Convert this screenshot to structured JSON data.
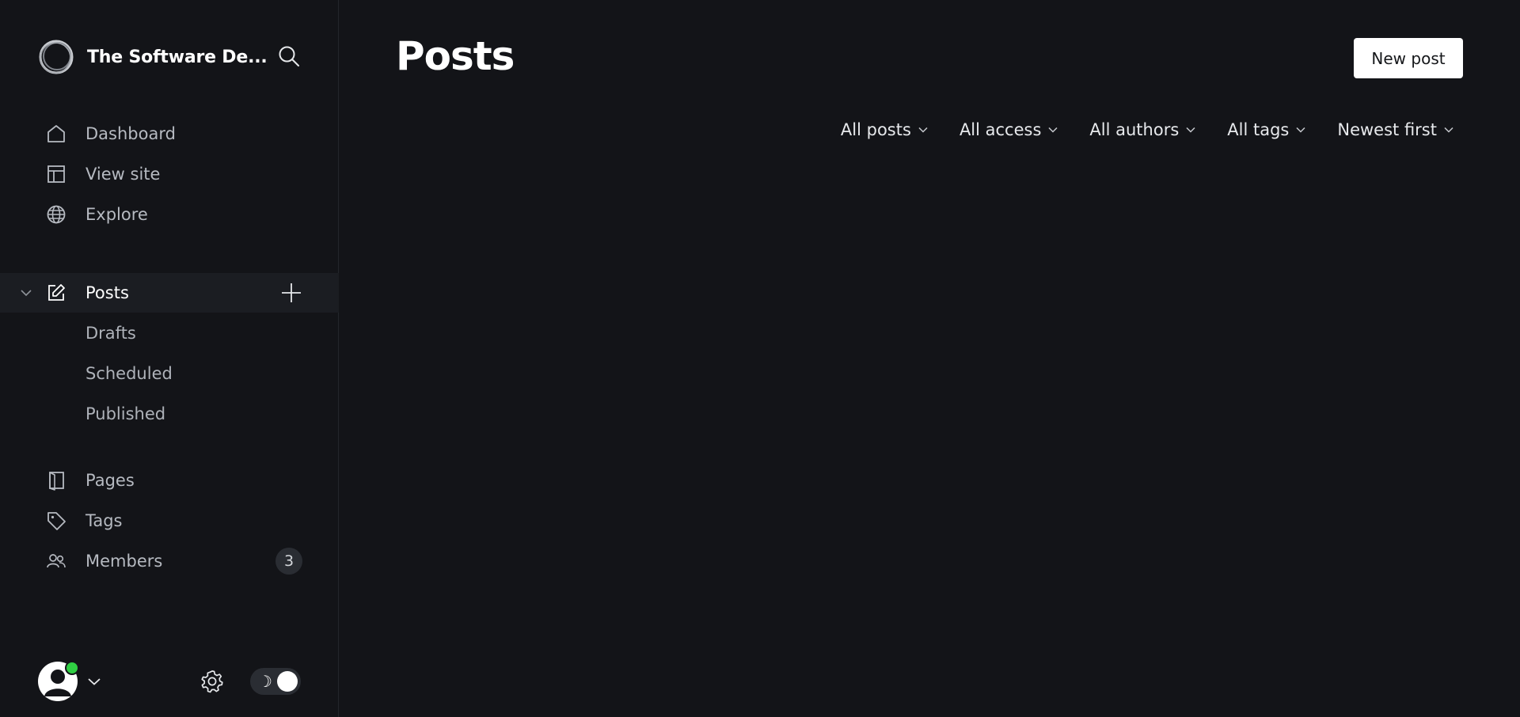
{
  "sidebar": {
    "site_title": "The Software De...",
    "nav_primary": [
      {
        "label": "Dashboard",
        "icon": "home-icon"
      },
      {
        "label": "View site",
        "icon": "layout-icon"
      },
      {
        "label": "Explore",
        "icon": "globe-icon"
      }
    ],
    "posts": {
      "label": "Posts",
      "icon": "edit-icon",
      "sub_items": [
        {
          "label": "Drafts"
        },
        {
          "label": "Scheduled"
        },
        {
          "label": "Published"
        }
      ]
    },
    "nav_secondary": [
      {
        "label": "Pages",
        "icon": "pages-icon"
      },
      {
        "label": "Tags",
        "icon": "tag-icon"
      },
      {
        "label": "Members",
        "icon": "members-icon",
        "badge": "3"
      }
    ],
    "footer": {
      "theme_toggle_symbol": "☽",
      "online_color": "#30cf43"
    }
  },
  "main": {
    "title": "Posts",
    "new_post_label": "New post",
    "filters": [
      {
        "label": "All posts"
      },
      {
        "label": "All access"
      },
      {
        "label": "All authors"
      },
      {
        "label": "All tags"
      },
      {
        "label": "Newest first"
      }
    ]
  },
  "colors": {
    "background": "#131418",
    "sidebar_active": "#1b1d22",
    "text_primary": "#ffffff",
    "text_muted": "#b6bac1",
    "button_bg": "#ffffff"
  }
}
